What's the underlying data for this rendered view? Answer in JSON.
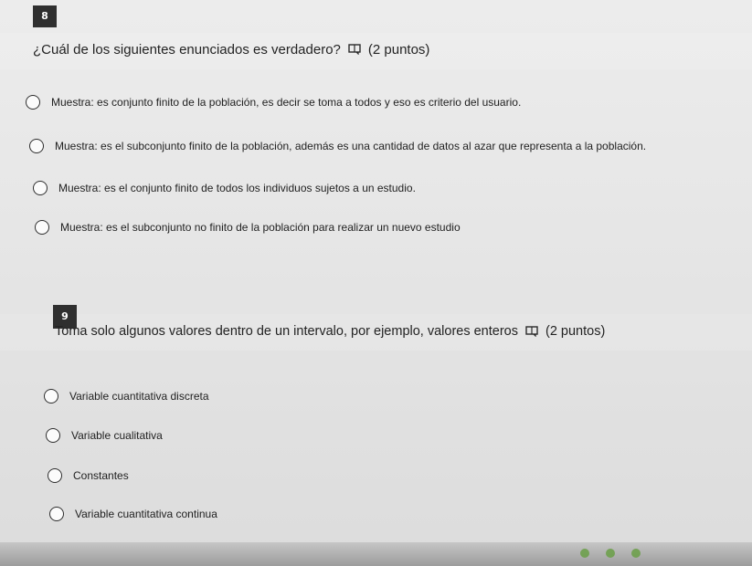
{
  "questions": [
    {
      "number": "8",
      "title": "¿Cuál de los siguientes enunciados es verdadero?",
      "points": "(2 puntos)",
      "reader_icon": "immersive-reader-icon",
      "options": [
        "Muestra: es conjunto finito de la población, es decir se toma a todos y eso es criterio del usuario.",
        "Muestra: es el subconjunto finito de la población, además es una cantidad de datos al azar que representa a la población.",
        "Muestra: es el conjunto finito de todos los individuos sujetos a un estudio.",
        "Muestra: es el subconjunto no finito de la población para realizar un nuevo estudio"
      ]
    },
    {
      "number": "9",
      "title": "Toma solo algunos valores dentro de un intervalo, por ejemplo, valores enteros",
      "points": "(2 puntos)",
      "reader_icon": "immersive-reader-icon",
      "options": [
        "Variable cuantitativa discreta",
        "Variable cualitativa",
        "Constantes",
        "Variable cuantitativa continua"
      ]
    }
  ],
  "colors": {
    "badge": "#2f2f2f",
    "text": "#1f1f1f",
    "background": "#e4e4e4"
  }
}
